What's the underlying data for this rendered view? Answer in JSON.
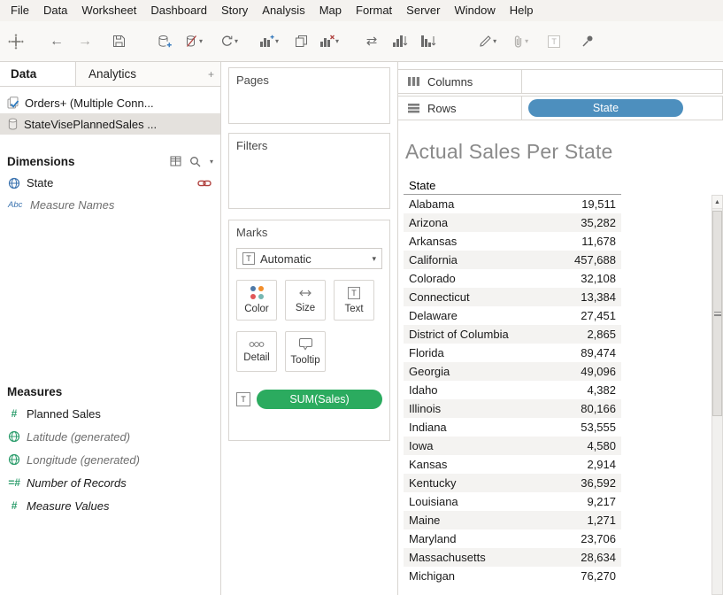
{
  "window": {
    "menu": [
      "File",
      "Data",
      "Worksheet",
      "Dashboard",
      "Story",
      "Analysis",
      "Map",
      "Format",
      "Server",
      "Window",
      "Help"
    ]
  },
  "toolbar": {
    "icons": [
      "tableau-logo",
      "undo-arrow",
      "redo-arrow",
      "save",
      "new-data-source",
      "pause-auto-updates",
      "run-auto-updates",
      "new-worksheet",
      "duplicate-sheet",
      "clear-sheet",
      "swap-rows-columns",
      "sort-ascending",
      "sort-descending",
      "highlight",
      "attach",
      "show-mark-labels",
      "pin"
    ]
  },
  "data_pane": {
    "tabs": {
      "data": "Data",
      "analytics": "Analytics"
    },
    "datasources": [
      {
        "name": "Orders+ (Multiple Conn...",
        "selected": false
      },
      {
        "name": "StateVisePlannedSales ...",
        "selected": true
      }
    ],
    "dimensions": {
      "header": "Dimensions",
      "fields": [
        {
          "name": "State"
        },
        {
          "name": "Measure Names"
        }
      ]
    },
    "measures": {
      "header": "Measures",
      "fields": [
        {
          "name": "Planned Sales"
        },
        {
          "name": "Latitude (generated)"
        },
        {
          "name": "Longitude (generated)"
        },
        {
          "name": "Number of Records"
        },
        {
          "name": "Measure Values"
        }
      ]
    }
  },
  "cards": {
    "pages": "Pages",
    "filters": "Filters",
    "marks": {
      "title": "Marks",
      "mark_type": "Automatic",
      "color": "Color",
      "size": "Size",
      "text": "Text",
      "detail": "Detail",
      "tooltip": "Tooltip",
      "pill": "SUM(Sales)"
    }
  },
  "shelves": {
    "columns": "Columns",
    "rows": "Rows",
    "rows_pill": "State"
  },
  "sheet": {
    "title": "Actual Sales Per State",
    "column_header": "State"
  },
  "colors": {
    "pill_blue": "#4d8fbe",
    "pill_green": "#2bab5f",
    "dimension_blue": "#3b73af",
    "measure_green": "#2f9e6e",
    "link_red": "#b0413e",
    "mark_color_dots": [
      "#4e79a7",
      "#f28e2b",
      "#e15759",
      "#76b7b2"
    ]
  },
  "chart_data": {
    "type": "table",
    "title": "Actual Sales Per State",
    "columns": [
      "State",
      "SUM(Sales)"
    ],
    "rows": [
      [
        "Alabama",
        "19,511"
      ],
      [
        "Arizona",
        "35,282"
      ],
      [
        "Arkansas",
        "11,678"
      ],
      [
        "California",
        "457,688"
      ],
      [
        "Colorado",
        "32,108"
      ],
      [
        "Connecticut",
        "13,384"
      ],
      [
        "Delaware",
        "27,451"
      ],
      [
        "District of Columbia",
        "2,865"
      ],
      [
        "Florida",
        "89,474"
      ],
      [
        "Georgia",
        "49,096"
      ],
      [
        "Idaho",
        "4,382"
      ],
      [
        "Illinois",
        "80,166"
      ],
      [
        "Indiana",
        "53,555"
      ],
      [
        "Iowa",
        "4,580"
      ],
      [
        "Kansas",
        "2,914"
      ],
      [
        "Kentucky",
        "36,592"
      ],
      [
        "Louisiana",
        "9,217"
      ],
      [
        "Maine",
        "1,271"
      ],
      [
        "Maryland",
        "23,706"
      ],
      [
        "Massachusetts",
        "28,634"
      ],
      [
        "Michigan",
        "76,270"
      ]
    ]
  }
}
